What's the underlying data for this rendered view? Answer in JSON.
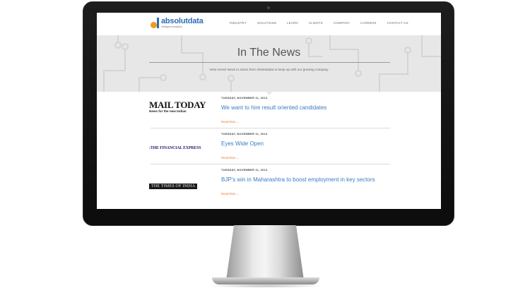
{
  "brand": {
    "name": "absolutdata",
    "tagline": "Intelligent Analytics"
  },
  "nav": [
    {
      "label": "INDUSTRY"
    },
    {
      "label": "SOLUTIONS"
    },
    {
      "label": "LEARN"
    },
    {
      "label": "CLIENTS"
    },
    {
      "label": "COMPANY"
    },
    {
      "label": "CAREERS"
    },
    {
      "label": "CONTACT US"
    }
  ],
  "hero": {
    "title": "In The News",
    "subtitle": "View recent News in action from Absolutdata to keep up with our growing company"
  },
  "news": [
    {
      "publication": {
        "line1": "MAIL TODAY",
        "line2": "News for the new Indian"
      },
      "date": "TUESDAY, NOVEMBER 11, 2014",
      "headline": "We want to hire result oriented candidates",
      "more": "Read More"
    },
    {
      "publication": {
        "line1": ":THE FINANCIAL EXPRESS"
      },
      "date": "TUESDAY, NOVEMBER 11, 2014",
      "headline": "Eyes Wide Open",
      "more": "Read More"
    },
    {
      "publication": {
        "line1": "THE TIMES OF INDIA"
      },
      "date": "TUESDAY, NOVEMBER 11, 2014",
      "headline": "BJP's win in Maharashtra to boost employment in key sectors",
      "more": "Read More"
    }
  ],
  "colors": {
    "brand_blue": "#2c6cb6",
    "brand_orange": "#f39a1e",
    "link_blue": "#3b7cc2",
    "read_more_orange": "#e97b2f",
    "hero_bg": "#e7e7e7"
  }
}
